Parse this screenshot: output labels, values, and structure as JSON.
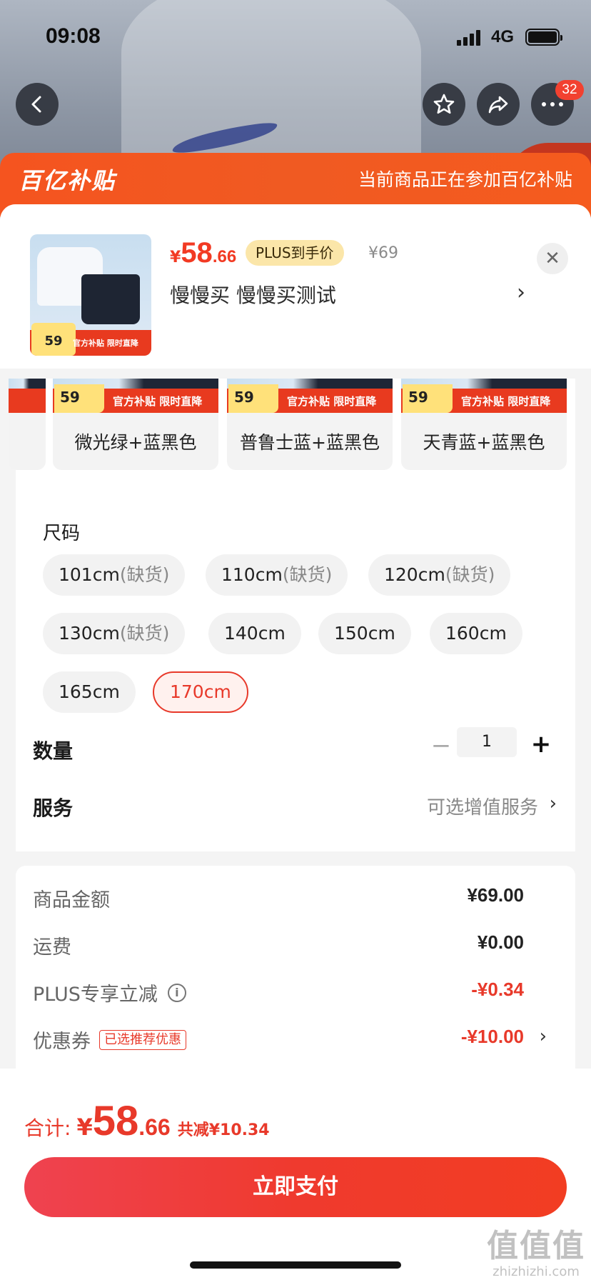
{
  "status_bar": {
    "time": "09:08",
    "network": "4G"
  },
  "nav": {
    "more_badge": "32"
  },
  "subsidy_banner": {
    "logo": "百亿补贴",
    "note": "当前商品正在参加百亿补贴"
  },
  "product": {
    "price_symbol": "¥",
    "price_int": "58",
    "price_dec": ".66",
    "plus_tag": "PLUS到手价",
    "original_price": "¥69",
    "title": "慢慢买  慢慢买测试",
    "thumb_promo_price": "59",
    "thumb_promo_text": "官方补贴 限时直降",
    "close_symbol": "✕",
    "arrow": "›"
  },
  "colors": {
    "promo_price": "59",
    "promo_text": "官方补贴 限时直降",
    "items": [
      {
        "label": ""
      },
      {
        "label": "微光绿+蓝黑色"
      },
      {
        "label": "普鲁士蓝+蓝黑色"
      },
      {
        "label": "天青蓝+蓝黑色"
      }
    ]
  },
  "sizes": {
    "title": "尺码",
    "out_of_stock": "(缺货)",
    "items": [
      {
        "label": "101cm",
        "oos": true
      },
      {
        "label": "110cm",
        "oos": true
      },
      {
        "label": "120cm",
        "oos": true
      },
      {
        "label": "130cm",
        "oos": true
      },
      {
        "label": "140cm",
        "oos": false
      },
      {
        "label": "150cm",
        "oos": false
      },
      {
        "label": "160cm",
        "oos": false
      },
      {
        "label": "165cm",
        "oos": false
      },
      {
        "label": "170cm",
        "oos": false,
        "selected": true
      }
    ]
  },
  "quantity": {
    "label": "数量",
    "value": "1",
    "minus": "−",
    "plus": "+"
  },
  "service": {
    "label": "服务",
    "value": "可选增值服务",
    "arrow": "›"
  },
  "summary": {
    "goods_amount": {
      "label": "商品金额",
      "value": "¥69.00"
    },
    "shipping": {
      "label": "运费",
      "value": "¥0.00"
    },
    "plus_discount": {
      "label": "PLUS专享立减",
      "value": "-¥0.34",
      "info": "i"
    },
    "coupon": {
      "label": "优惠券",
      "tag": "已选推荐优惠",
      "value": "-¥10.00",
      "arrow": "›"
    }
  },
  "footer": {
    "total_label": "合计:",
    "total_yen": "¥",
    "total_int": "58",
    "total_dec": ".66",
    "saved": "共减¥10.34",
    "pay_button": "立即支付"
  },
  "watermark": {
    "line1": "值值值",
    "line2": "zhizhizhi.com"
  },
  "theme": {
    "accent": "#e8392a",
    "banner": "#f5541f"
  }
}
